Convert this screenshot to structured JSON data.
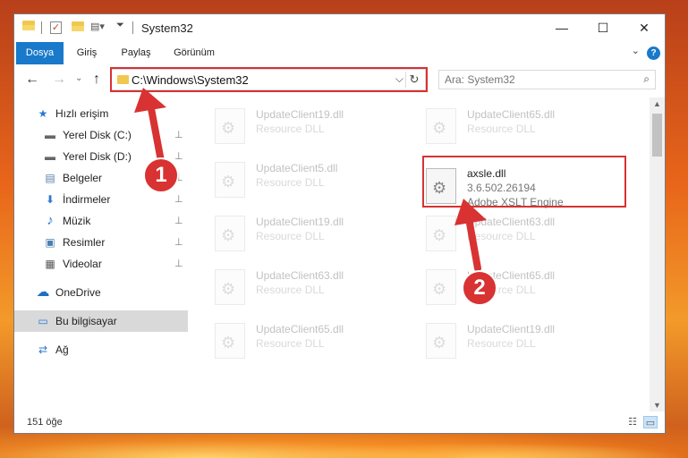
{
  "window": {
    "title": "System32",
    "controls": {
      "minimize": "—",
      "maximize": "☐",
      "close": "✕"
    }
  },
  "ribbon": {
    "tabs": [
      "Dosya",
      "Giriş",
      "Paylaş",
      "Görünüm"
    ],
    "active_tab": "Dosya",
    "help": "?"
  },
  "nav": {
    "back": "←",
    "forward": "→",
    "up": "↑",
    "address": "C:\\Windows\\System32",
    "dropdown": "⌵",
    "refresh": "↻",
    "search_placeholder": "Ara: System32",
    "search_icon": "⌕"
  },
  "sidebar": {
    "items": [
      {
        "label": "Hızlı erişim",
        "icon": "star-icon",
        "glyph": "★",
        "pinned": false
      },
      {
        "label": "Yerel Disk (C:)",
        "icon": "drive-icon",
        "glyph": "▬",
        "pinned": true
      },
      {
        "label": "Yerel Disk (D:)",
        "icon": "drive-icon",
        "glyph": "▬",
        "pinned": true
      },
      {
        "label": "Belgeler",
        "icon": "documents-icon",
        "glyph": "▤",
        "pinned": true
      },
      {
        "label": "İndirmeler",
        "icon": "download-icon",
        "glyph": "⬇",
        "pinned": true
      },
      {
        "label": "Müzik",
        "icon": "music-icon",
        "glyph": "♪",
        "pinned": true
      },
      {
        "label": "Resimler",
        "icon": "pictures-icon",
        "glyph": "▣",
        "pinned": true
      },
      {
        "label": "Videolar",
        "icon": "videos-icon",
        "glyph": "▦",
        "pinned": true
      },
      {
        "label": "OneDrive",
        "icon": "cloud-icon",
        "glyph": "☁",
        "pinned": false
      },
      {
        "label": "Bu bilgisayar",
        "icon": "computer-icon",
        "glyph": "▭",
        "pinned": false,
        "selected": true
      },
      {
        "label": "Ağ",
        "icon": "network-icon",
        "glyph": "⇄",
        "pinned": false
      }
    ],
    "pin_glyph": "📌"
  },
  "files": {
    "items": [
      {
        "name": "UpdateClient19.dll",
        "desc": "Resource DLL",
        "faded": true
      },
      {
        "name": "UpdateClient65.dll",
        "desc": "Resource DLL",
        "faded": true
      },
      {
        "name": "UpdateClient5.dll",
        "desc": "Resource DLL",
        "faded": true
      },
      {
        "name": "axsle.dll",
        "desc": "3.6.502.26194",
        "desc2": "Adobe XSLT Engine",
        "faded": false
      },
      {
        "name": "UpdateClient19.dll",
        "desc": "Resource DLL",
        "faded": true
      },
      {
        "name": "UpdateClient63.dll",
        "desc": "Resource DLL",
        "faded": true
      },
      {
        "name": "UpdateClient63.dll",
        "desc": "Resource DLL",
        "faded": true
      },
      {
        "name": "UpdateClient65.dll",
        "desc": "Resource DLL",
        "faded": true
      },
      {
        "name": "UpdateClient65.dll",
        "desc": "Resource DLL",
        "faded": true
      },
      {
        "name": "UpdateClient19.dll",
        "desc": "Resource DLL",
        "faded": true
      }
    ]
  },
  "status": {
    "count": "151 öğe"
  },
  "annotations": {
    "badge1": "1",
    "badge2": "2",
    "color": "#d83232"
  },
  "colors": {
    "accent": "#1979ca",
    "highlight": "#d83232"
  }
}
